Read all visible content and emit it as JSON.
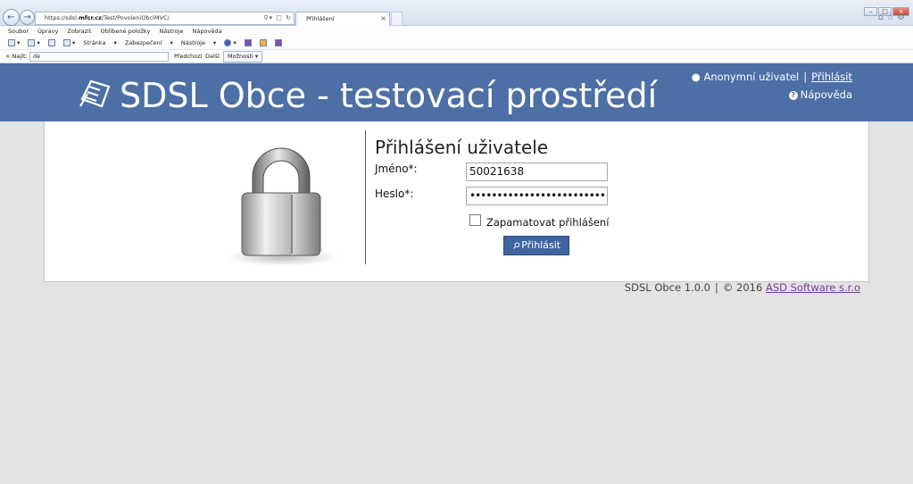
{
  "browser": {
    "url_prefix": "https://sdsl.",
    "url_host": "mfcr.cz",
    "url_path": "/Test/PovoleniObciMVC/",
    "tab_title": "Přihlášení",
    "menu": [
      "Soubor",
      "Úpravy",
      "Zobrazit",
      "Oblíbené položky",
      "Nástroje",
      "Nápověda"
    ],
    "commands": {
      "page": "Stránka",
      "security": "Zabezpečení",
      "tools": "Nástroje"
    },
    "find": {
      "label": "Najít:",
      "value": "de",
      "prev": "Předchozí",
      "next": "Další",
      "options": "Možnosti"
    }
  },
  "header": {
    "title": "SDSL Obce - testovací prostředí",
    "user": "Anonymní uživatel",
    "login_link": "Přihlásit",
    "help_link": "Nápověda"
  },
  "login": {
    "title": "Přihlášení uživatele",
    "username_label": "Jméno*:",
    "username_value": "50021638",
    "password_label": "Heslo*:",
    "password_value": "••••••••••••••••••••••••••••",
    "remember_label": "Zapamatovat přihlášení",
    "remember_checked": false,
    "submit_label": "Přihlásit"
  },
  "footer": {
    "version": "SDSL Obce 1.0.0",
    "copyright": "© 2016",
    "company_link": "ASD Software s.r.o"
  },
  "colors": {
    "header_bg": "#4c6fa6",
    "button_bg": "#3f64a0",
    "page_bg": "#e3e3e3",
    "link_visited": "#7a3a9a"
  }
}
